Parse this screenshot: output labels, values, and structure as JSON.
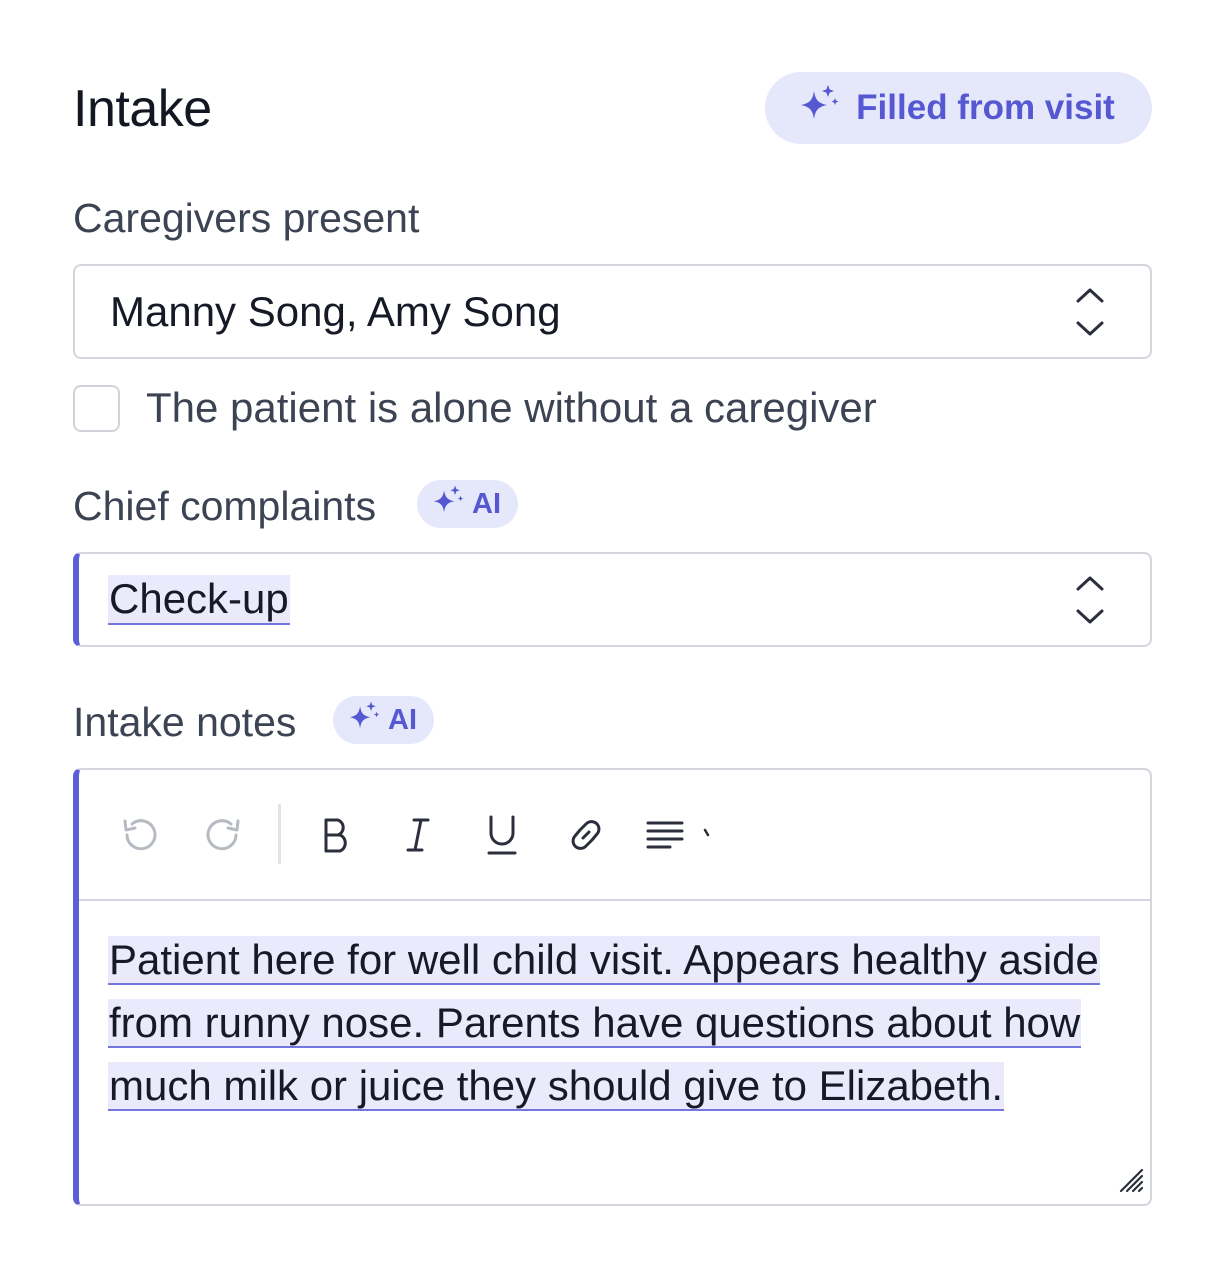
{
  "header": {
    "title": "Intake",
    "filled_badge_label": "Filled from visit"
  },
  "caregivers": {
    "label": "Caregivers present",
    "value": "Manny Song, Amy Song",
    "alone_checkbox_label": "The patient is alone without a caregiver",
    "alone_checked": false
  },
  "chief_complaints": {
    "label": "Chief complaints",
    "ai_badge": "AI",
    "value": "Check-up"
  },
  "intake_notes": {
    "label": "Intake notes",
    "ai_badge": "AI",
    "text": "Patient here for well child visit. Appears healthy aside from runny nose. Parents have questions about how much milk or juice they should give to Elizabeth."
  },
  "toolbar": {
    "buttons": [
      "undo-icon",
      "redo-icon",
      "bold-icon",
      "italic-icon",
      "underline-icon",
      "link-icon",
      "align-left-icon",
      "more-chevron-icon"
    ]
  },
  "colors": {
    "accent": "#5b5ed6",
    "accent_bg": "#e5e7fb",
    "border": "#d3d6dc"
  }
}
